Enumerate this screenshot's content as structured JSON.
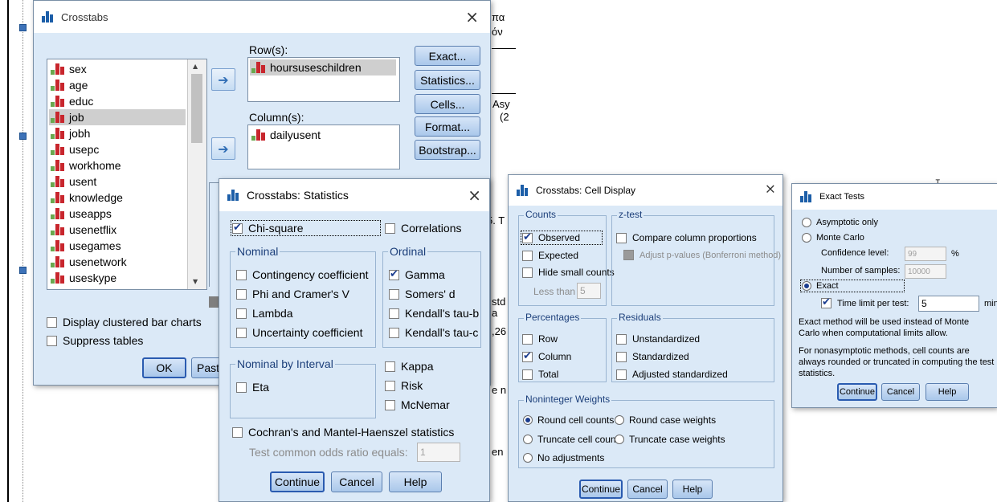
{
  "background": {
    "fragments": [
      "πα",
      "όν",
      "Asy",
      "(2",
      "5. T",
      "std",
      "a",
      ",26",
      "e n",
      "en",
      ".T"
    ]
  },
  "crosstabs": {
    "title": "Crosstabs",
    "variables": [
      "sex",
      "age",
      "educ",
      "job",
      "jobh",
      "usepc",
      "workhome",
      "usent",
      "knowledge",
      "useapps",
      "usenetflix",
      "usegames",
      "usenetwork",
      "useskype"
    ],
    "selected_variable": "job",
    "row_label": "Row(s):",
    "row_items": [
      "hoursuseschildren"
    ],
    "column_label": "Column(s):",
    "column_items": [
      "dailyusent"
    ],
    "side_buttons": [
      "Exact...",
      "Statistics...",
      "Cells...",
      "Format...",
      "Bootstrap..."
    ],
    "display_clustered": "Display clustered bar charts",
    "suppress_tables": "Suppress tables",
    "ok": "OK",
    "paste": "Past"
  },
  "statistics": {
    "title": "Crosstabs: Statistics",
    "chi_square": "Chi-square",
    "correlations": "Correlations",
    "nominal_group": "Nominal",
    "nominal_items": [
      "Contingency coefficient",
      "Phi and Cramer's V",
      "Lambda",
      "Uncertainty coefficient"
    ],
    "ordinal_group": "Ordinal",
    "ordinal_items": [
      "Gamma",
      "Somers' d",
      "Kendall's tau-b",
      "Kendall's tau-c"
    ],
    "interval_group": "Nominal by Interval",
    "eta": "Eta",
    "kappa": "Kappa",
    "risk": "Risk",
    "mcnemar": "McNemar",
    "cochran": "Cochran's and Mantel-Haenszel statistics",
    "odds_label": "Test common odds ratio equals:",
    "odds_value": "1",
    "continue": "Continue",
    "cancel": "Cancel",
    "help": "Help"
  },
  "cells": {
    "title": "Crosstabs: Cell Display",
    "counts_group": "Counts",
    "observed": "Observed",
    "expected": "Expected",
    "hide_small": "Hide small counts",
    "less_than": "Less than",
    "less_than_value": "5",
    "ztest_group": "z-test",
    "compare_cols": "Compare column proportions",
    "adjust_p": "Adjust p-values (Bonferroni method)",
    "percentages_group": "Percentages",
    "row": "Row",
    "column": "Column",
    "total": "Total",
    "residuals_group": "Residuals",
    "unstandardized": "Unstandardized",
    "standardized": "Standardized",
    "adjusted": "Adjusted standardized",
    "weights_group": "Noninteger Weights",
    "round_cell": "Round cell counts",
    "round_case": "Round case weights",
    "truncate_cell": "Truncate cell counts",
    "truncate_case": "Truncate case weights",
    "no_adjust": "No adjustments",
    "continue": "Continue",
    "cancel": "Cancel",
    "help": "Help"
  },
  "exact": {
    "title": "Exact Tests",
    "asymptotic": "Asymptotic only",
    "monte_carlo": "Monte Carlo",
    "confidence_label": "Confidence level:",
    "confidence_value": "99",
    "percent": "%",
    "samples_label": "Number of samples:",
    "samples_value": "10000",
    "exact": "Exact",
    "time_limit": "Time limit per test:",
    "time_value": "5",
    "minutes": "minute",
    "note1": "Exact method will be used instead of Monte Carlo when computational limits allow.",
    "note2": "For nonasymptotic methods, cell counts are always rounded or truncated in computing the test statistics.",
    "continue": "Continue",
    "cancel": "Cancel",
    "help": "Help"
  },
  "colors": {
    "dialog_bg": "#dbe9f7",
    "group_label": "#1c3f7a",
    "check": "#1b3d8f",
    "var_icon_red": "#c8262d",
    "var_icon_green": "#6aa84f"
  }
}
